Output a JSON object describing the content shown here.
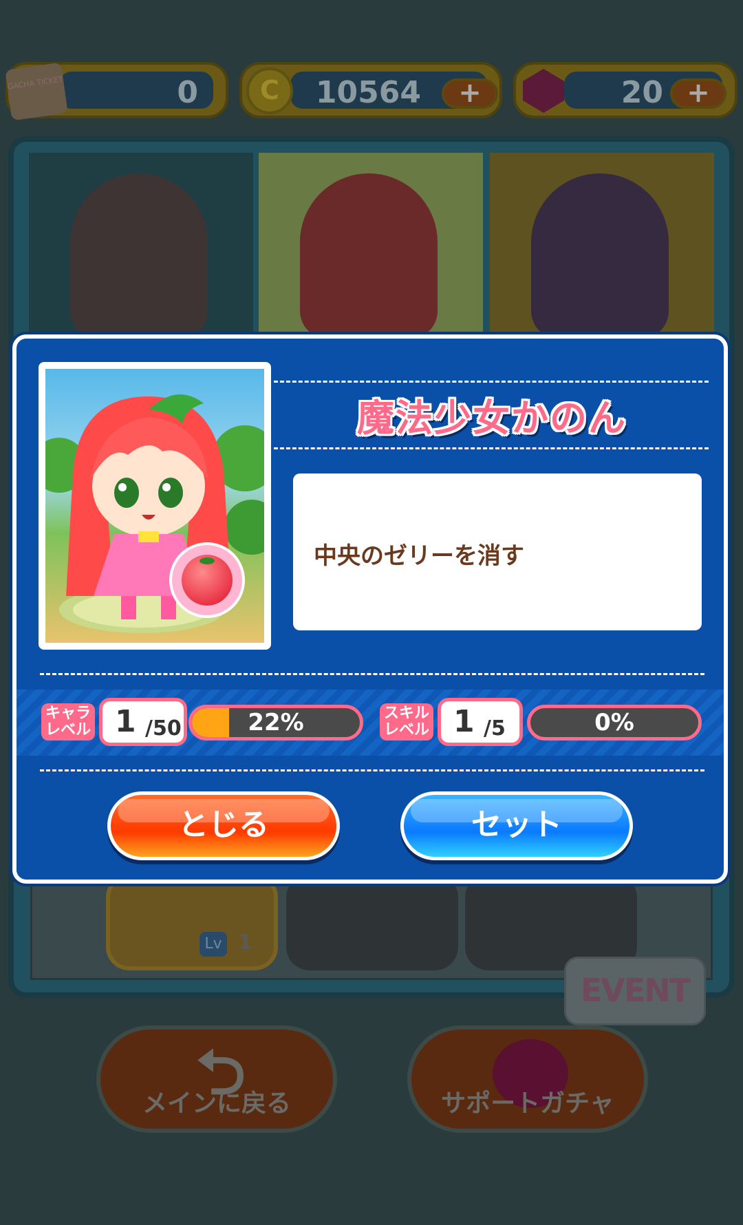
{
  "top_bar": {
    "tickets": {
      "value": "0",
      "icon": "gacha-ticket-icon",
      "icon_text": "GACHA TICKET"
    },
    "coins": {
      "value": "10564",
      "icon": "coin-icon",
      "icon_text": "C",
      "add_label": "+"
    },
    "gems": {
      "value": "20",
      "icon": "gem-icon",
      "add_label": "+"
    }
  },
  "background": {
    "team_slots": [
      {
        "name": "chef-character"
      },
      {
        "name": "magical-girl-kanon"
      },
      {
        "name": "purple-hair-character"
      }
    ],
    "support_slots": [
      {
        "level_label": "Lv",
        "level": "1"
      },
      {
        "locked": true
      },
      {
        "locked": true
      }
    ],
    "event_label": "EVENT",
    "back_button_label": "メインに戻る",
    "support_gacha_label": "サポートガチャ"
  },
  "modal": {
    "character_name": "魔法少女かのん",
    "skill_description": "中央のゼリーを消す",
    "attribute_icon": "tomato-icon",
    "char_level": {
      "tag": "キャラ\nレベル",
      "current": "1",
      "max": "/50",
      "progress": 22,
      "progress_text": "22%"
    },
    "skill_level": {
      "tag": "スキル\nレベル",
      "current": "1",
      "max": "/5",
      "progress": 0,
      "progress_text": "0%"
    },
    "close_label": "とじる",
    "set_label": "セット"
  },
  "colors": {
    "modal_bg": "#0a4fa8",
    "name_pink": "#ff6a8a",
    "close_btn": "#ff4a0a",
    "set_btn": "#1a9cff",
    "progress_fill": "#ffa414"
  }
}
